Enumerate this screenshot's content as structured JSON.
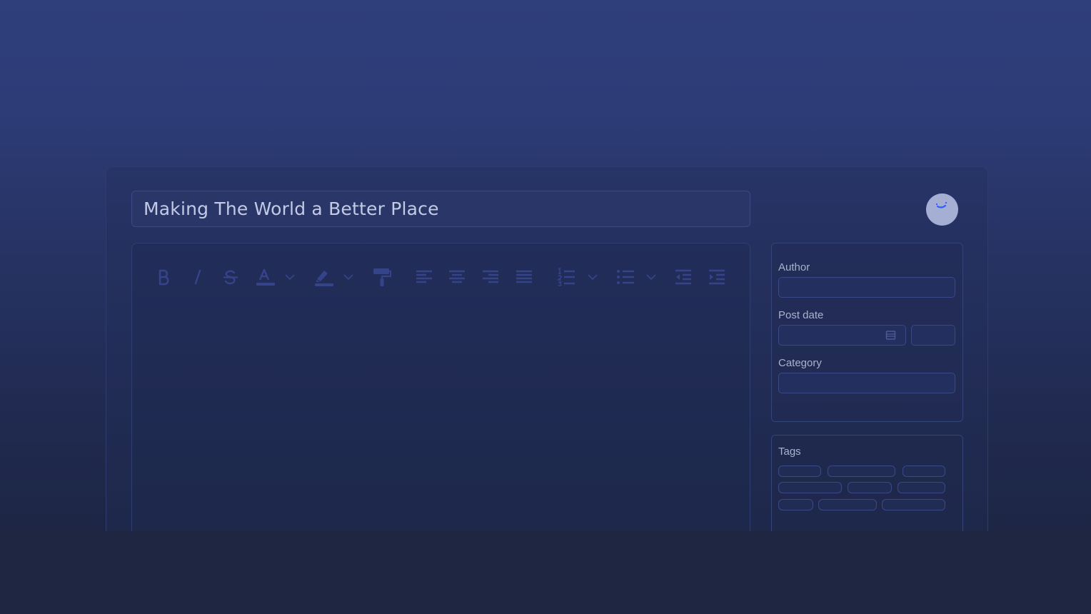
{
  "post": {
    "title": "Making The World a Better Place"
  },
  "toolbar": {
    "items": [
      "bold",
      "italic",
      "strikethrough",
      "font-color",
      "highlight",
      "format-painter",
      "align-left",
      "align-center",
      "align-right",
      "align-justify",
      "ordered-list",
      "unordered-list",
      "outdent",
      "indent"
    ]
  },
  "sidebar": {
    "author_label": "Author",
    "post_date_label": "Post date",
    "category_label": "Category"
  },
  "tags": {
    "label": "Tags"
  },
  "colors": {
    "background_top": "#2f3f7c",
    "background_bottom": "#1d2540",
    "border": "#3a4986",
    "toolbar_icon": "#34438a",
    "text": "#c3cae6",
    "avatar": "#a5aed3",
    "accent": "#2f5bff"
  }
}
